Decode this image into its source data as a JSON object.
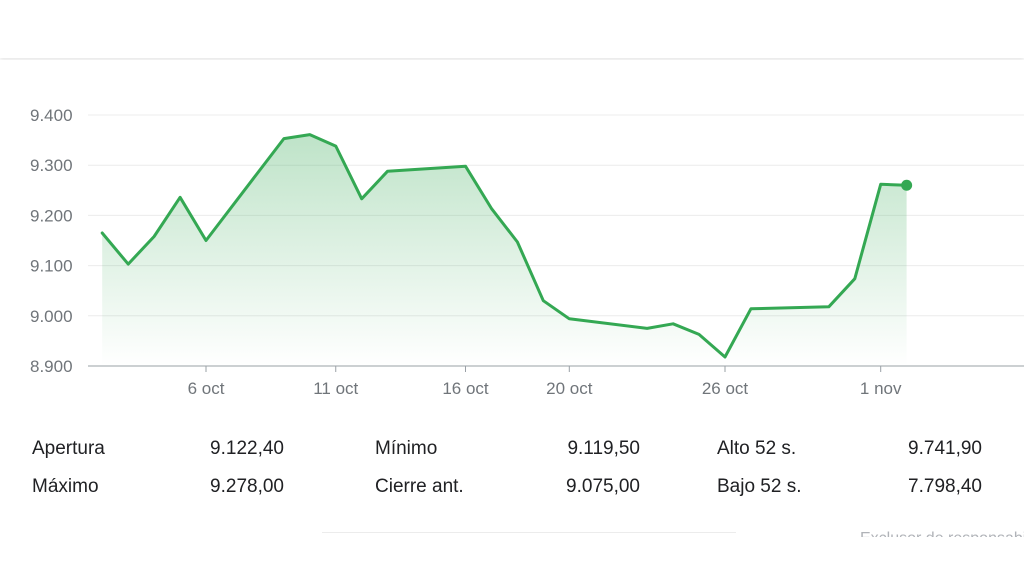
{
  "chart_data": {
    "type": "area",
    "y_ticks": [
      "9.400",
      "9.300",
      "9.200",
      "9.100",
      "9.000",
      "8.900"
    ],
    "y_tick_values": [
      9400,
      9300,
      9200,
      9100,
      9000,
      8900
    ],
    "ylim": [
      8900,
      9400
    ],
    "x_ticks": [
      "6 oct",
      "11 oct",
      "16 oct",
      "20 oct",
      "26 oct",
      "1 nov"
    ],
    "x_tick_dates": [
      "2023-10-06",
      "2023-10-11",
      "2023-10-16",
      "2023-10-20",
      "2023-10-26",
      "2023-11-01"
    ],
    "x": [
      "2023-10-02",
      "2023-10-03",
      "2023-10-04",
      "2023-10-05",
      "2023-10-06",
      "2023-10-09",
      "2023-10-10",
      "2023-10-11",
      "2023-10-12",
      "2023-10-13",
      "2023-10-16",
      "2023-10-17",
      "2023-10-18",
      "2023-10-19",
      "2023-10-20",
      "2023-10-23",
      "2023-10-24",
      "2023-10-25",
      "2023-10-26",
      "2023-10-27",
      "2023-10-30",
      "2023-10-31",
      "2023-11-01",
      "2023-11-02"
    ],
    "values": [
      9165,
      9103,
      9158,
      9236,
      9150,
      9353,
      9361,
      9338,
      9233,
      9288,
      9298,
      9214,
      9147,
      9030,
      8994,
      8975,
      8984,
      8963,
      8918,
      9014,
      9018,
      9074,
      9262,
      9260
    ],
    "grid": true,
    "line_color": "#34a853",
    "fill_color": "#34a853"
  },
  "stats": {
    "apertura_label": "Apertura",
    "apertura_value": "9.122,40",
    "maximo_label": "Máximo",
    "maximo_value": "9.278,00",
    "minimo_label": "Mínimo",
    "minimo_value": "9.119,50",
    "cierre_label": "Cierre ant.",
    "cierre_value": "9.075,00",
    "alto52_label": "Alto 52 s.",
    "alto52_value": "9.741,90",
    "bajo52_label": "Bajo 52 s.",
    "bajo52_value": "7.798,40"
  },
  "footer": {
    "cut_text": "Exclusor de responsabilidad"
  }
}
